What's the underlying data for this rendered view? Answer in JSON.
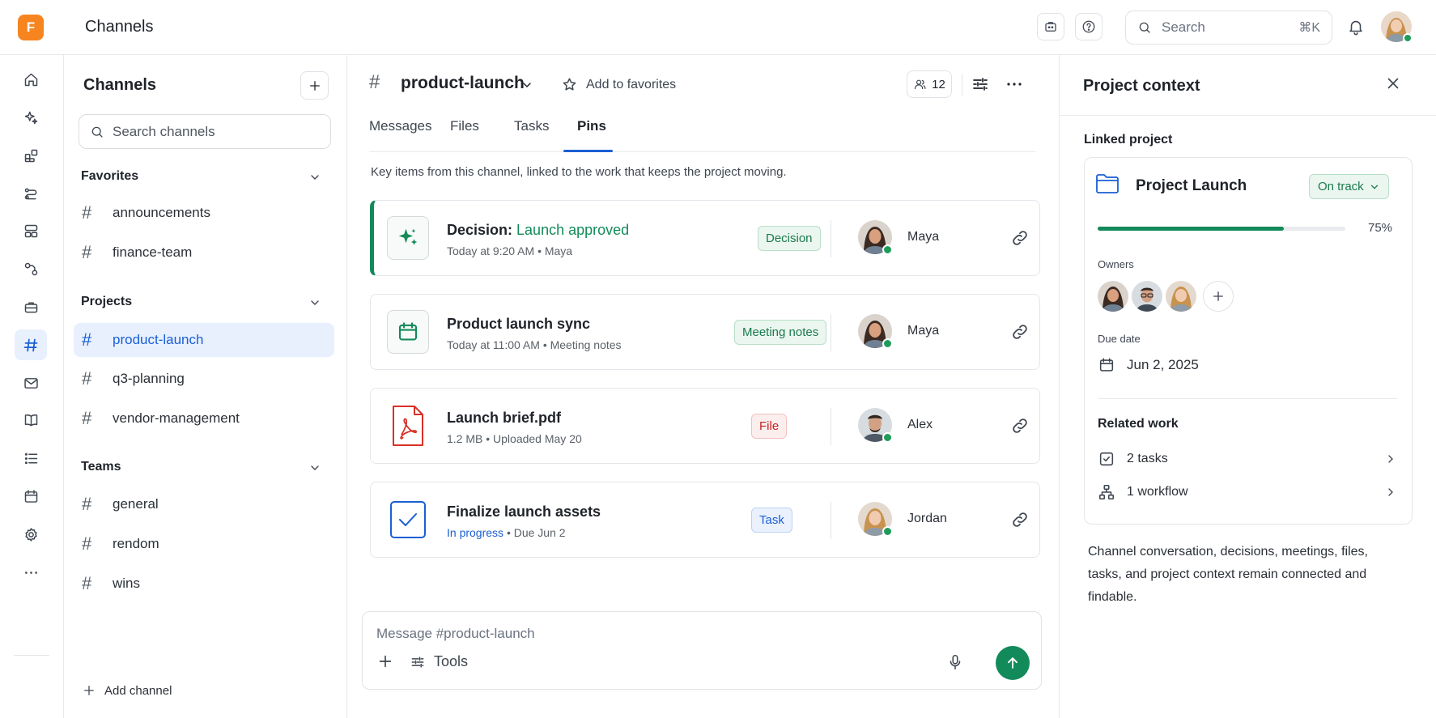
{
  "app": {
    "logo_letter": "F",
    "title": "Channels"
  },
  "topbar": {
    "search_placeholder": "Search",
    "search_shortcut": "⌘K"
  },
  "sidebar": {
    "title": "Channels",
    "search_placeholder": "Search channels",
    "sections": [
      {
        "label": "Favorites",
        "channels": [
          "announcements",
          "finance-team"
        ]
      },
      {
        "label": "Projects",
        "channels": [
          "product-launch",
          "q3-planning",
          "vendor-management"
        ]
      },
      {
        "label": "Teams",
        "channels": [
          "general",
          "rendom",
          "wins"
        ]
      }
    ],
    "add_channel": "Add channel"
  },
  "channel": {
    "hash": "#",
    "name": "product-launch",
    "add_favorites": "Add to favorites",
    "member_count": "12",
    "tabs": [
      "Messages",
      "Files",
      "Tasks",
      "Pins"
    ],
    "active_tab": "Pins",
    "intro": "Key items from this channel, linked to the work that keeps the project moving."
  },
  "pins": [
    {
      "title_prefix": "Decision: ",
      "title_accent": "Launch approved",
      "title": "",
      "meta": "Today at 9:20 AM • Maya",
      "tag": "Decision",
      "person": "Maya",
      "icon": "sparkle-icon"
    },
    {
      "title": "Product launch sync",
      "meta": "Today at 11:00 AM • Meeting notes",
      "tag": "Meeting notes",
      "person": "Maya",
      "icon": "calendar-icon"
    },
    {
      "title": "Launch brief.pdf",
      "meta": "1.2 MB • Uploaded May 20",
      "tag": "File",
      "person": "Alex",
      "icon": "pdf-icon"
    },
    {
      "title": "Finalize launch assets",
      "meta_status": "In progress",
      "meta": "• Due Jun 2",
      "tag": "Task",
      "person": "Jordan",
      "icon": "checkbox-icon"
    }
  ],
  "composer": {
    "placeholder": "Message #product-launch",
    "tools_label": "Tools"
  },
  "project_panel": {
    "title": "Project context",
    "linked_label": "Linked project",
    "project_name": "Project Launch",
    "status": "On track",
    "progress": 75,
    "progress_label": "75%",
    "owners_label": "Owners",
    "due_label": "Due date",
    "due_date": "Jun 2, 2025",
    "related_label": "Related work",
    "related": [
      {
        "label": "2 tasks",
        "icon": "task-icon"
      },
      {
        "label": "1 workflow",
        "icon": "workflow-icon"
      }
    ],
    "footer": "Channel conversation, decisions, meetings, files, tasks, and project context remain connected and findable."
  },
  "colors": {
    "accent": "#1a5fd4",
    "success": "#138a5a",
    "danger": "#c5221f",
    "logo": "#f6851f"
  }
}
